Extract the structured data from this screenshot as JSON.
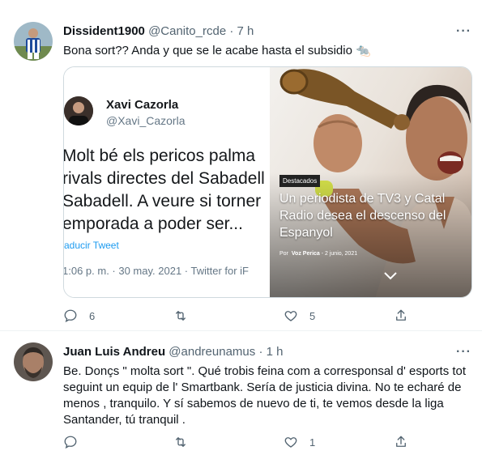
{
  "tweet1": {
    "name": "Dissident1900",
    "handle": "@Canito_rcde",
    "time": "· 7 h",
    "text": "Bona sort?? Anda y que se le acabe hasta el subsidio 🐀",
    "embedded": {
      "name": "Xavi Cazorla",
      "handle": "@Xavi_Cazorla",
      "lines": [
        "Molt bé els pericos palma",
        "rivals directes del Sabadell",
        "Sabadell. A veure si torner",
        "emporada a poder ser..."
      ],
      "translate": "raducir Tweet",
      "timestamp": "1:06 p. m. · 30 may. 2021 · Twitter for iF"
    },
    "article": {
      "tag": "Destacados",
      "headline": "Un periodista de TV3 y Catal Radio desea el descenso del Espanyol",
      "by_prefix": "Por",
      "author": "Voz Perica",
      "date": "- 2 junio, 2021"
    },
    "replies": "6",
    "retweets": "",
    "likes": "5"
  },
  "tweet2": {
    "name": "Juan Luis Andreu",
    "handle": "@andreunamus",
    "time": "· 1 h",
    "lines": [
      "Be. Donçs \" molta sort \". Qué trobis feina com a corresponsal d' esports tot",
      "seguint un equip de l' Smartbank.  Sería de justicia divina. No te echaré de",
      "menos , tranquilo.  Y sí sabemos de nuevo de ti, te vemos desde la liga",
      "Santander, tú tranquil ."
    ],
    "replies": "",
    "retweets": "",
    "likes": "1"
  },
  "more_label": "···",
  "colors": {
    "text": "#0f1419",
    "secondary": "#536471",
    "link": "#1d9bf0",
    "divider": "#eff3f4"
  }
}
